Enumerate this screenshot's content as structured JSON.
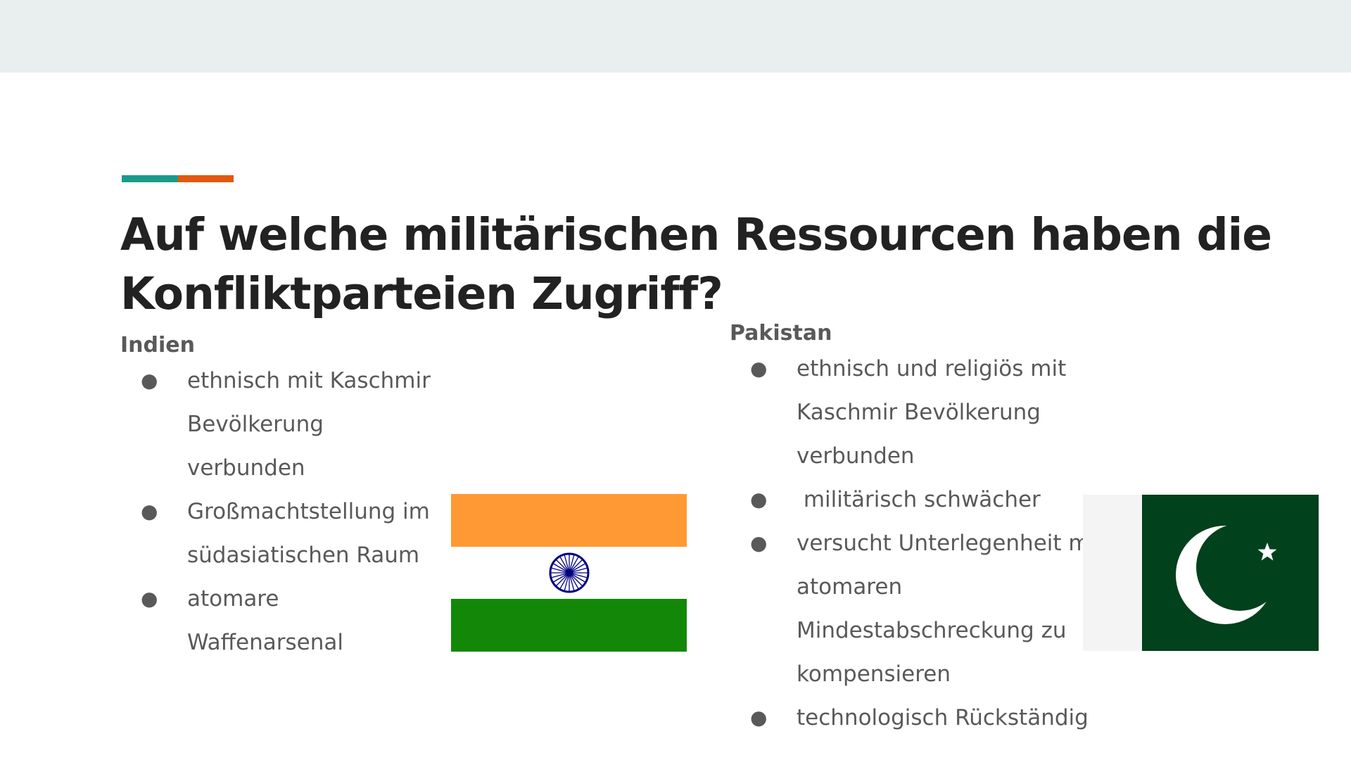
{
  "slide": {
    "title_line1": "Auf welche militärischen Ressourcen haben die",
    "title_line2": "Konfliktparteien Zugriff?"
  },
  "colors": {
    "accent_teal": "#1a9a8b",
    "accent_orange": "#e2580f",
    "india_saffron": "#ff9933",
    "india_green": "#138808",
    "india_chakra": "#000080",
    "pakistan_green": "#01411c"
  },
  "india": {
    "heading": "Indien",
    "items": [
      {
        "lines": [
          "ethnisch mit Kaschmir",
          "Bevölkerung",
          "verbunden"
        ]
      },
      {
        "lines": [
          "Großmachtstellung im",
          "südasiatischen Raum"
        ]
      },
      {
        "lines": [
          "atomare",
          "Waffenarsenal"
        ]
      }
    ],
    "flag_icon": "india-flag-icon"
  },
  "pakistan": {
    "heading": "Pakistan",
    "items": [
      {
        "lines": [
          "ethnisch und religiös mit",
          "Kaschmir Bevölkerung",
          "verbunden"
        ]
      },
      {
        "lines": [
          " militärisch schwächer"
        ]
      },
      {
        "lines": [
          "versucht Unterlegenheit m",
          "atomaren",
          "Mindestabschreckung zu",
          "kompensieren"
        ]
      },
      {
        "lines": [
          "technologisch Rückständig"
        ]
      }
    ],
    "flag_icon": "pakistan-flag-icon"
  },
  "bullet_char": "●"
}
